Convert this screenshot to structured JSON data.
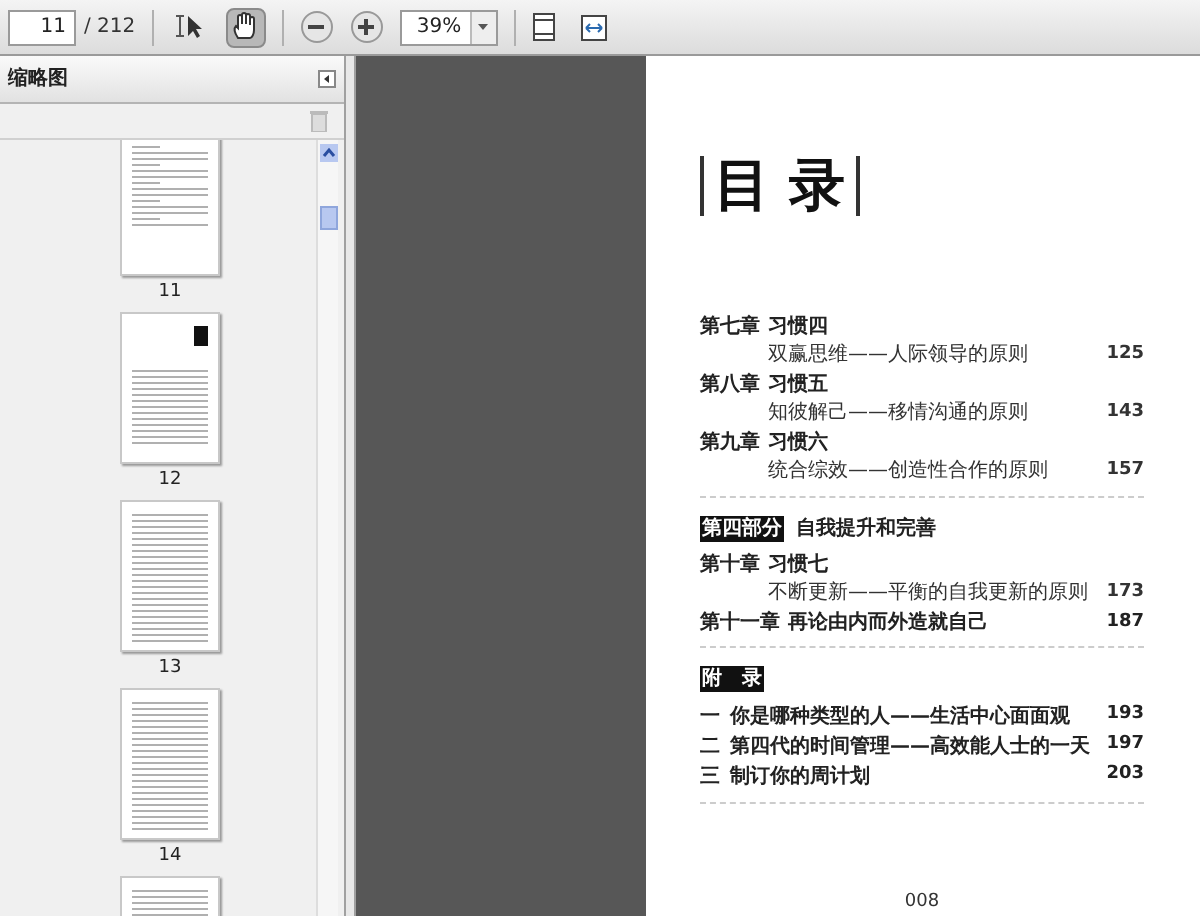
{
  "toolbar": {
    "page_input": "11",
    "page_count": "/ 212",
    "tools": [
      {
        "kind": "select",
        "selected": false
      },
      {
        "kind": "hand",
        "selected": true
      }
    ],
    "zoom": "39%"
  },
  "sidebar": {
    "title": "缩略图",
    "thumbnails": [
      {
        "label": "11",
        "kind": "toc"
      },
      {
        "label": "12",
        "kind": "cover"
      },
      {
        "label": "13",
        "kind": "text"
      },
      {
        "label": "14",
        "kind": "text"
      },
      {
        "kind": "text"
      }
    ]
  },
  "page": {
    "title": "目 录",
    "entries": [
      {
        "kind": "chapter",
        "number": "第七章",
        "title": "习惯四"
      },
      {
        "kind": "sub",
        "title": "双赢思维——人际领导的原则",
        "page": "125"
      },
      {
        "kind": "chapter",
        "number": "第八章",
        "title": "习惯五"
      },
      {
        "kind": "sub",
        "title": "知彼解己——移情沟通的原则",
        "page": "143"
      },
      {
        "kind": "chapter",
        "number": "第九章",
        "title": "习惯六"
      },
      {
        "kind": "sub",
        "title": "统合综效——创造性合作的原则",
        "page": "157"
      },
      {
        "kind": "rule"
      },
      {
        "kind": "part",
        "number": "第四部分",
        "title": "自我提升和完善"
      },
      {
        "kind": "chapter",
        "number": "第十章",
        "title": "习惯七"
      },
      {
        "kind": "sub",
        "title": "不断更新——平衡的自我更新的原则",
        "page": "173"
      },
      {
        "kind": "chapter",
        "number": "第十一章",
        "title": "再论由内而外造就自己",
        "page": "187"
      },
      {
        "kind": "rule"
      },
      {
        "kind": "part",
        "number": "附　录"
      },
      {
        "kind": "item",
        "number": "一",
        "title": "你是哪种类型的人——生活中心面面观",
        "page": "193"
      },
      {
        "kind": "item",
        "number": "二",
        "title": "第四代的时间管理——高效能人士的一天",
        "page": "197"
      },
      {
        "kind": "item",
        "number": "三",
        "title": "制订你的周计划",
        "page": "203"
      },
      {
        "kind": "rule"
      }
    ],
    "footer": "008"
  }
}
